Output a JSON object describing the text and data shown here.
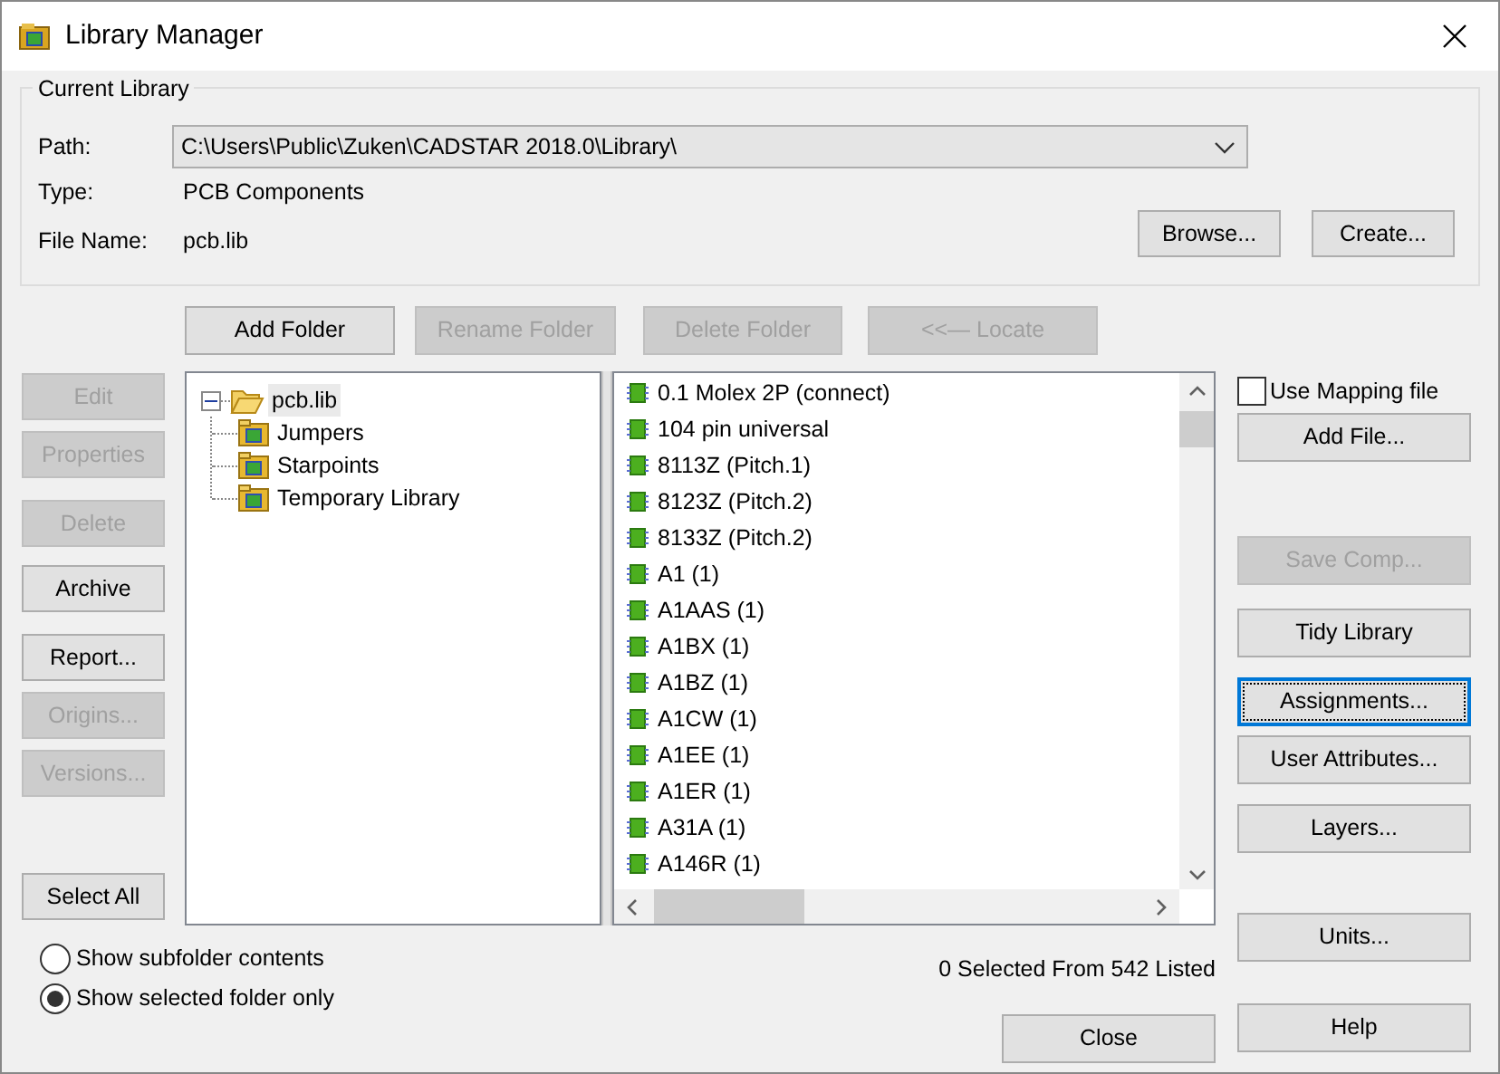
{
  "window": {
    "title": "Library Manager"
  },
  "current_library": {
    "label": "Current Library",
    "path_label": "Path:",
    "path": "C:\\Users\\Public\\Zuken\\CADSTAR 2018.0\\Library\\",
    "type_label": "Type:",
    "type": "PCB Components",
    "file_name_label": "File Name:",
    "file_name": "pcb.lib",
    "buttons": [
      {
        "label": "Browse...",
        "disabled": false
      },
      {
        "label": "Create...",
        "disabled": false
      }
    ]
  },
  "folder_buttons": [
    {
      "label": "Add Folder",
      "disabled": false
    },
    {
      "label": "Rename Folder",
      "disabled": true
    },
    {
      "label": "Delete Folder",
      "disabled": true
    },
    {
      "label": "<<— Locate",
      "disabled": true
    }
  ],
  "left_buttons": [
    {
      "label": "Edit",
      "disabled": true
    },
    {
      "label": "Properties",
      "disabled": true
    },
    {
      "label": "Delete",
      "disabled": true
    },
    {
      "label": "Archive",
      "disabled": false
    },
    {
      "label": "Report...",
      "disabled": false
    },
    {
      "label": "Origins...",
      "disabled": true
    },
    {
      "label": "Versions...",
      "disabled": true
    },
    {
      "label": "Select All",
      "disabled": false
    }
  ],
  "tree": [
    {
      "label": "pcb.lib",
      "expanded": true,
      "selected": true,
      "children": [
        {
          "label": "Jumpers",
          "selected": false
        },
        {
          "label": "Starpoints",
          "selected": false
        },
        {
          "label": "Temporary Library",
          "selected": false
        }
      ]
    }
  ],
  "components": [
    "0.1 Molex 2P (connect)",
    "104 pin universal",
    "8113Z (Pitch.1)",
    "8123Z (Pitch.2)",
    "8133Z (Pitch.2)",
    "A1 (1)",
    "A1AAS (1)",
    "A1BX (1)",
    "A1BZ (1)",
    "A1CW (1)",
    "A1EE (1)",
    "A1ER (1)",
    "A31A (1)",
    "A146R (1)"
  ],
  "status": "0 Selected From 542 Listed",
  "view_options": [
    {
      "label": "Show subfolder contents",
      "selected": false
    },
    {
      "label": "Show selected folder only",
      "selected": true
    }
  ],
  "use_mapping_file": {
    "label": "Use Mapping file",
    "checked": false
  },
  "right_buttons": [
    {
      "label": "Add File...",
      "disabled": false,
      "focused": false
    },
    {
      "label": "Save Comp...",
      "disabled": true,
      "focused": false
    },
    {
      "label": "Tidy Library",
      "disabled": false,
      "focused": false
    },
    {
      "label": "Assignments...",
      "disabled": false,
      "focused": true
    },
    {
      "label": "User Attributes...",
      "disabled": false,
      "focused": false
    },
    {
      "label": "Layers...",
      "disabled": false,
      "focused": false
    },
    {
      "label": "Units...",
      "disabled": false,
      "focused": false
    }
  ],
  "bottom_buttons": [
    {
      "label": "Close",
      "disabled": false
    },
    {
      "label": "Help",
      "disabled": false
    }
  ]
}
